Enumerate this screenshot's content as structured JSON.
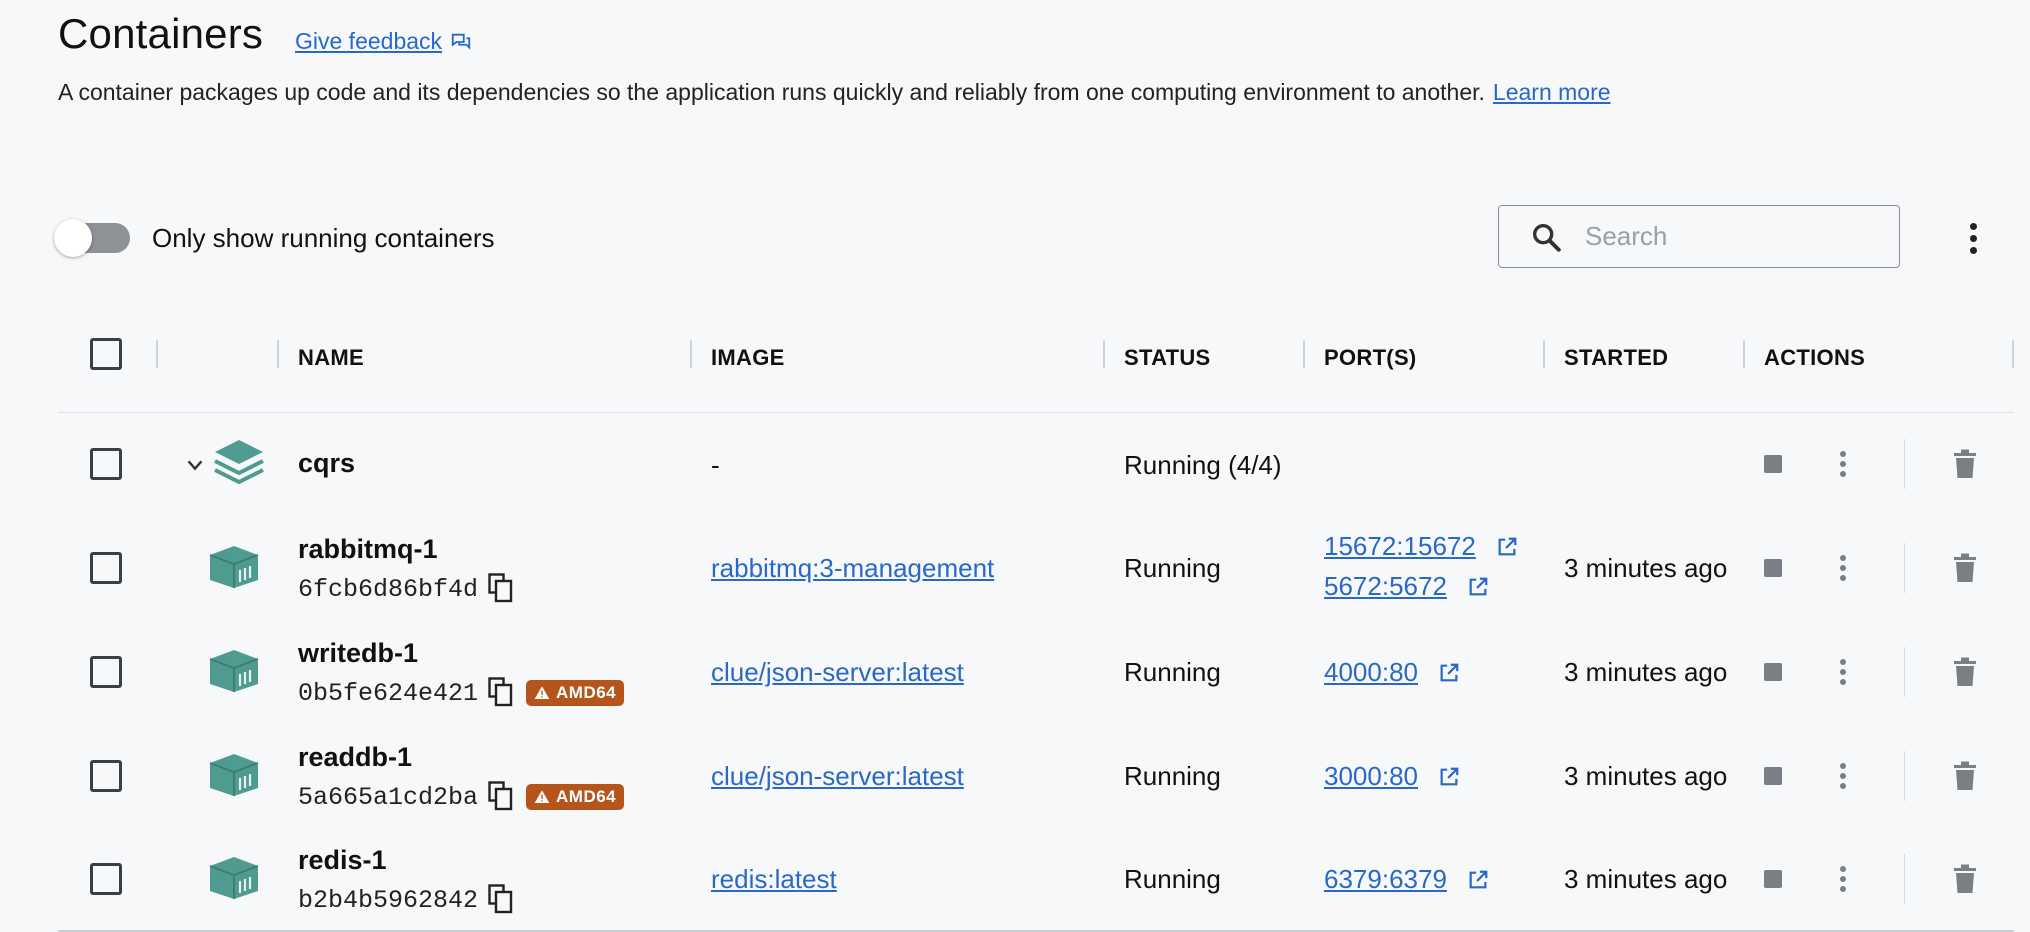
{
  "header": {
    "title": "Containers",
    "feedback_label": "Give feedback",
    "description": "A container packages up code and its dependencies so the application runs quickly and reliably from one computing environment to another.",
    "learn_more": "Learn more"
  },
  "toolbar": {
    "toggle_label": "Only show running containers",
    "toggle_on": false,
    "search_placeholder": "Search"
  },
  "table": {
    "columns": [
      "NAME",
      "IMAGE",
      "STATUS",
      "PORT(S)",
      "STARTED",
      "ACTIONS"
    ],
    "group": {
      "name": "cqrs",
      "image": "-",
      "status": "Running (4/4)"
    },
    "rows": [
      {
        "name": "rabbitmq-1",
        "id": "6fcb6d86bf4d",
        "badge": "",
        "image": "rabbitmq:3-management",
        "status": "Running",
        "ports": [
          "15672:15672",
          "5672:5672"
        ],
        "started": "3 minutes ago"
      },
      {
        "name": "writedb-1",
        "id": "0b5fe624e421",
        "badge": "AMD64",
        "image": "clue/json-server:latest",
        "status": "Running",
        "ports": [
          "4000:80"
        ],
        "started": "3 minutes ago"
      },
      {
        "name": "readdb-1",
        "id": "5a665a1cd2ba",
        "badge": "AMD64",
        "image": "clue/json-server:latest",
        "status": "Running",
        "ports": [
          "3000:80"
        ],
        "started": "3 minutes ago"
      },
      {
        "name": "redis-1",
        "id": "b2b4b5962842",
        "badge": "",
        "image": "redis:latest",
        "status": "Running",
        "ports": [
          "6379:6379"
        ],
        "started": "3 minutes ago"
      }
    ]
  },
  "colors": {
    "link": "#2a68c7",
    "badge": "#b5551c",
    "container_icon": "#4f9b8f",
    "action_icon": "#7a7f86"
  },
  "icons": [
    "feedback-icon",
    "search-icon",
    "more-vert-icon",
    "chevron-down-icon",
    "stack-icon",
    "container-icon",
    "copy-icon",
    "warning-icon",
    "external-link-icon",
    "stop-icon",
    "trash-icon"
  ]
}
